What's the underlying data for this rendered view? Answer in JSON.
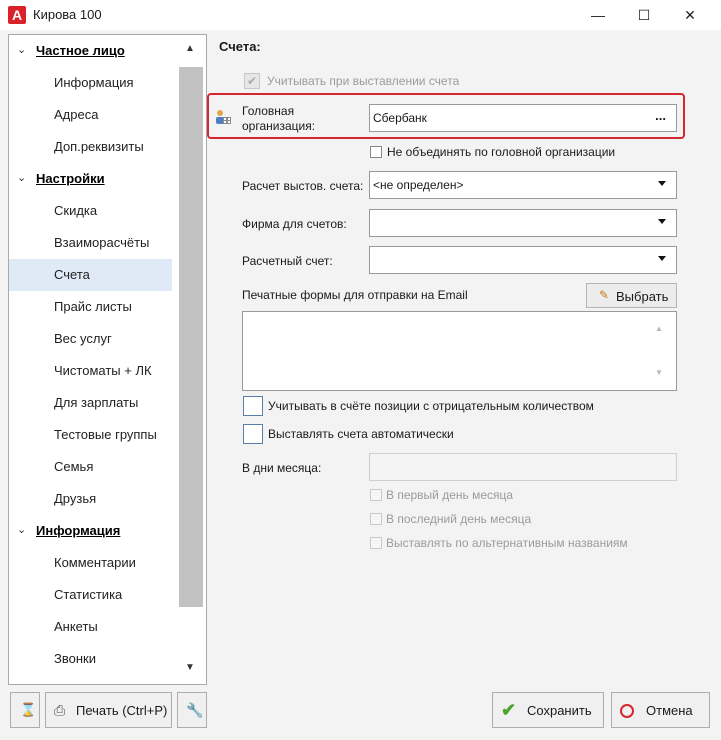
{
  "window": {
    "title": "Кирова 100",
    "icon": "app-logo-icon",
    "controls": [
      "minimize",
      "maximize",
      "close"
    ]
  },
  "sidebar": {
    "groups": [
      {
        "label": "Частное лицо",
        "items": [
          "Информация",
          "Адреса",
          "Доп.реквизиты"
        ]
      },
      {
        "label": "Настройки",
        "items": [
          "Скидка",
          "Взаиморасчёты",
          "Счета",
          "Прайс листы",
          "Вес услуг",
          "Чистоматы + ЛК",
          "Для зарплаты",
          "Тестовые группы",
          "Семья",
          "Друзья"
        ]
      },
      {
        "label": "Информация",
        "items": [
          "Комментарии",
          "Статистика",
          "Анкеты",
          "Звонки"
        ]
      }
    ],
    "selected": "Счета"
  },
  "content": {
    "section_title": "Счета:",
    "use_on_invoice_label": "Учитывать при выставлении счета",
    "head_org_label_1": "Головная",
    "head_org_label_2": "организация:",
    "head_org_value": "Сбербанк",
    "head_org_button": "...",
    "no_merge_label": "Не объединять по головной организации",
    "invoice_calc_label": "Расчет выстов. счета:",
    "invoice_calc_value": "<не определен>",
    "firm_label": "Фирма для счетов:",
    "firm_value": "",
    "account_label": "Расчетный счет:",
    "account_value": "",
    "email_forms_label": "Печатные формы для отправки на Email",
    "choose_button": "Выбрать",
    "negative_qty_label": "Учитывать в счёте позиции с отрицательным количеством",
    "auto_invoice_label": "Выставлять счета автоматически",
    "days_label": "В дни месяца:",
    "days_value": "",
    "first_day_label": "В первый день месяца",
    "last_day_label": "В последний день месяца",
    "alt_names_label": "Выставлять по альтернативным названиям"
  },
  "toolbar": {
    "print_label": "Печать (Ctrl+P)",
    "save_label": "Сохранить",
    "cancel_label": "Отмена"
  },
  "colors": {
    "highlight": "#d6262e",
    "selected_item": "#dfeaf6",
    "save_check": "#4aa52e",
    "cancel_icon": "#d6262e"
  }
}
